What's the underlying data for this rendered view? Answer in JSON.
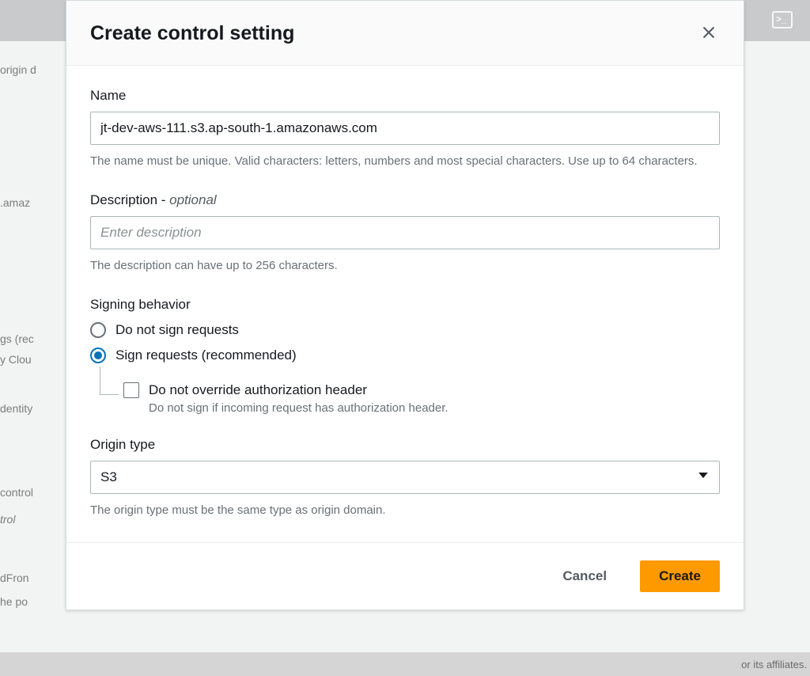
{
  "modal": {
    "title": "Create control setting",
    "name": {
      "label": "Name",
      "value": "jt-dev-aws-111.s3.ap-south-1.amazonaws.com",
      "helper": "The name must be unique. Valid characters: letters, numbers and most special characters. Use up to 64 characters."
    },
    "description": {
      "label": "Description - ",
      "optional": "optional",
      "placeholder": "Enter description",
      "value": "",
      "helper": "The description can have up to 256 characters."
    },
    "signing": {
      "label": "Signing behavior",
      "options": [
        {
          "label": "Do not sign requests",
          "selected": false
        },
        {
          "label": "Sign requests (recommended)",
          "selected": true
        }
      ],
      "sub_option": {
        "label": "Do not override authorization header",
        "helper": "Do not sign if incoming request has authorization header.",
        "checked": false
      }
    },
    "origin_type": {
      "label": "Origin type",
      "value": "S3",
      "helper": "The origin type must be the same type as origin domain."
    },
    "footer": {
      "cancel": "Cancel",
      "create": "Create"
    }
  },
  "background": {
    "texts": {
      "origin_d": "origin d",
      "amaz": ".amaz",
      "gs_rec": "gs (rec",
      "y_clou": "y Clou",
      "dentity": "dentity",
      "control": "control",
      "trol": "trol",
      "dfront": "dFron",
      "he_po": "he po",
      "affiliates": "or its affiliates."
    }
  }
}
